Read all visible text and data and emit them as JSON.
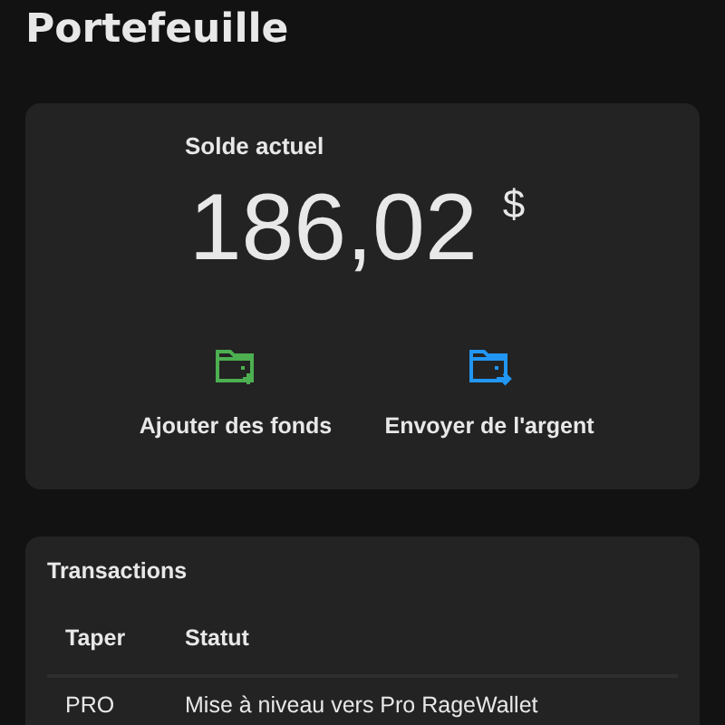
{
  "title": "Portefeuille",
  "balance": {
    "label": "Solde actuel",
    "amount": "186,02",
    "currency": "$"
  },
  "actions": [
    {
      "kind": "add",
      "label": "Ajouter des fonds",
      "color": "#4caf50"
    },
    {
      "kind": "send",
      "label": "Envoyer de l'argent",
      "color": "#2196f3"
    }
  ],
  "transactions": {
    "title": "Transactions",
    "columns": [
      "Taper",
      "Statut"
    ],
    "rows": [
      [
        "PRO",
        "Mise à niveau vers Pro RageWallet"
      ]
    ]
  }
}
